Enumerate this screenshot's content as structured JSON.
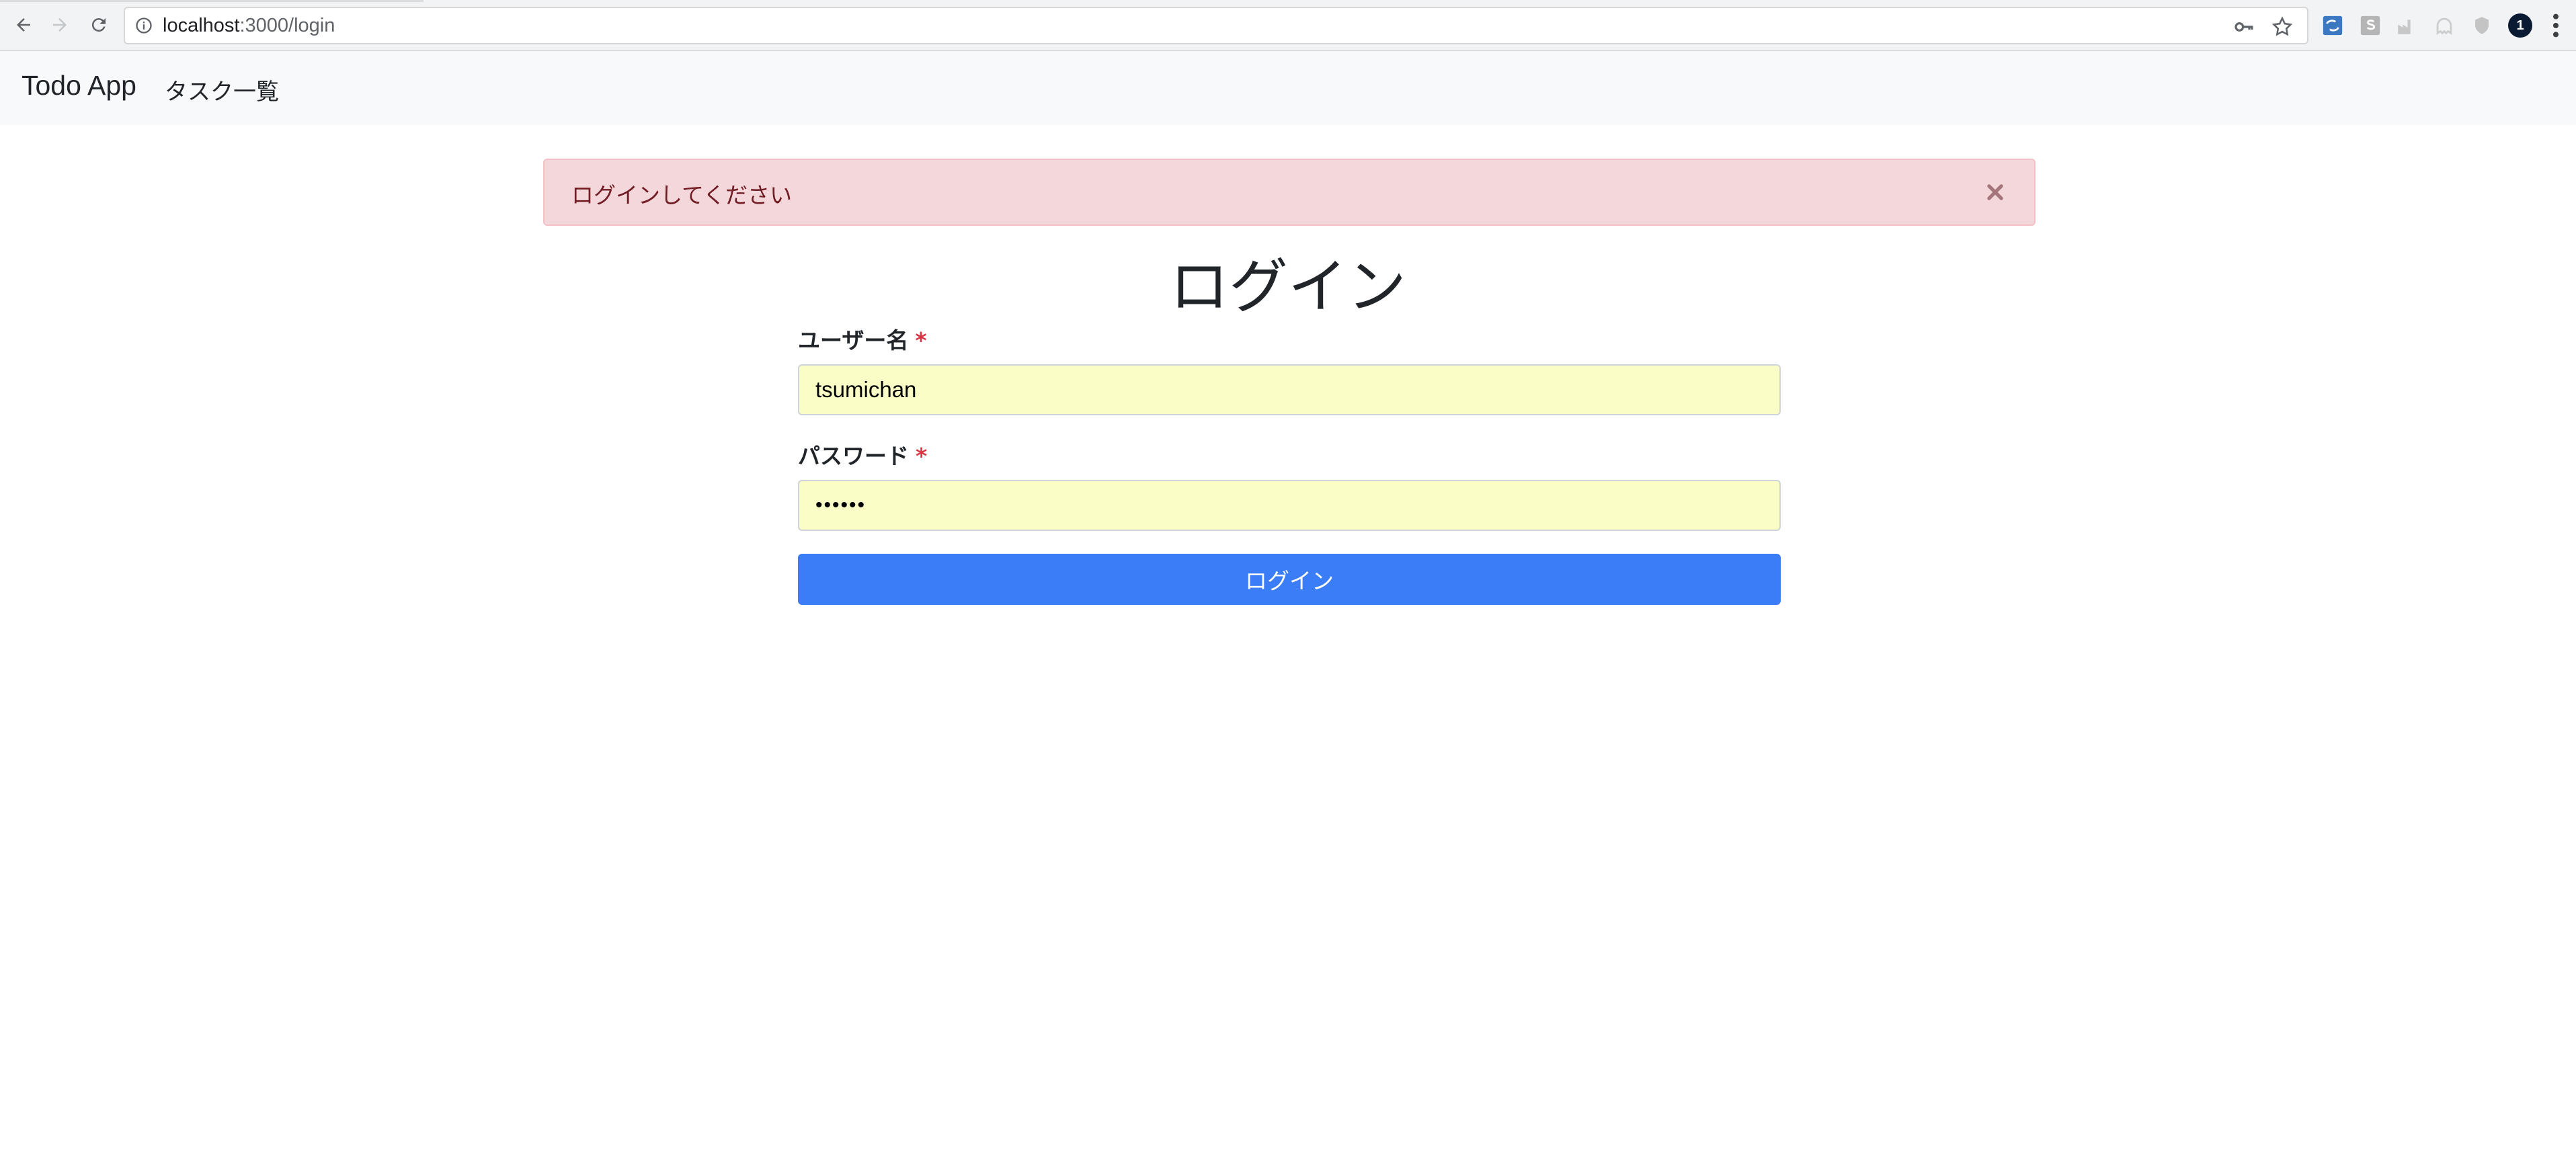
{
  "browser": {
    "url_host": "localhost",
    "url_path": ":3000/login",
    "notification_badge": "1"
  },
  "navbar": {
    "brand": "Todo App",
    "links": [
      {
        "label": "タスク一覧"
      }
    ]
  },
  "alert": {
    "message": "ログインしてください",
    "color": "#f4d7da"
  },
  "form": {
    "title": "ログイン",
    "username": {
      "label": "ユーザー名",
      "required_mark": "*",
      "value": "tsumichan"
    },
    "password": {
      "label": "パスワード",
      "required_mark": "*",
      "value": "••••••"
    },
    "submit_label": "ログイン",
    "accent_color": "#3b7df6"
  }
}
